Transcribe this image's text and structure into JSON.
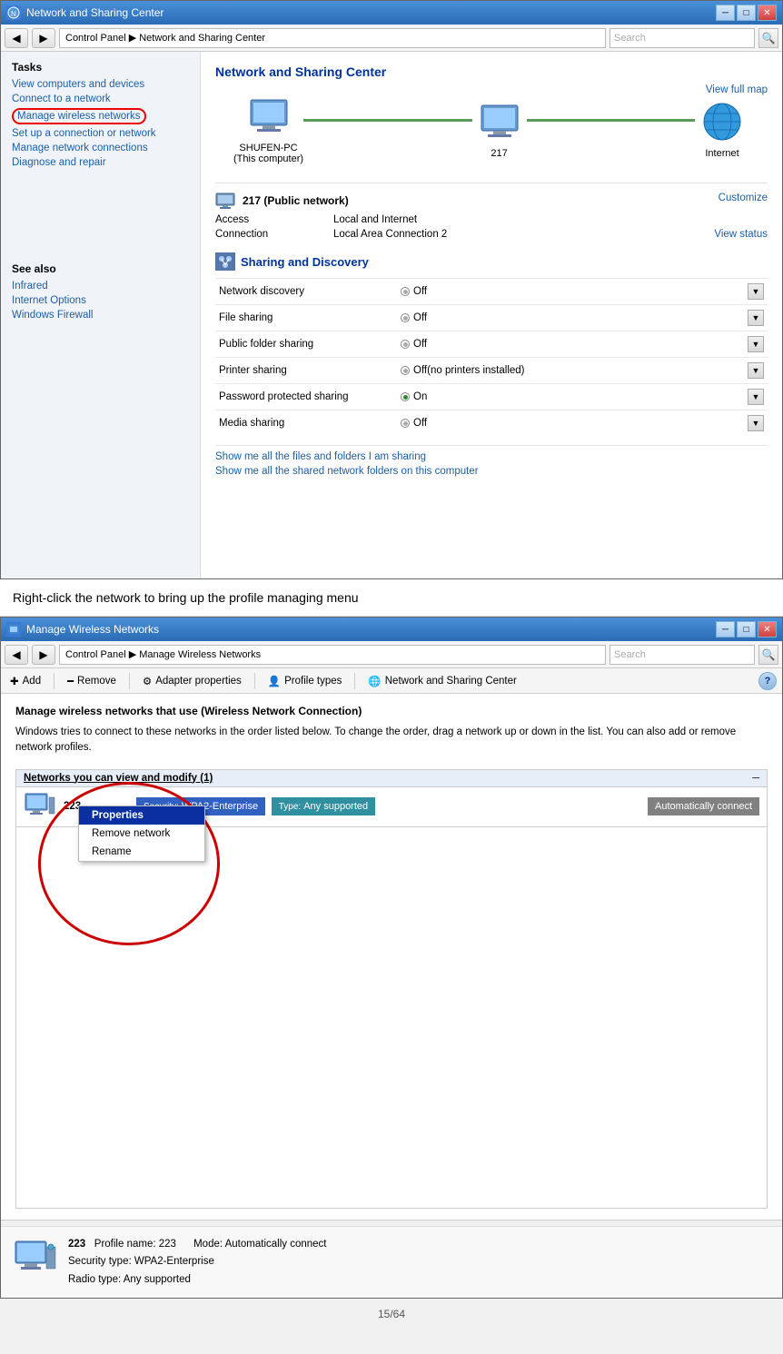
{
  "window1": {
    "title": "Network and Sharing Center",
    "address_bar": {
      "path": "Control Panel ▶ Network and Sharing Center",
      "search_placeholder": "Search"
    },
    "content_title": "Network and Sharing Center",
    "view_full_map": "View full map",
    "network_nodes": [
      {
        "label": "SHUFEN-PC\n(This computer)",
        "type": "computer"
      },
      {
        "label": "217",
        "type": "computer"
      },
      {
        "label": "Internet",
        "type": "globe"
      }
    ],
    "network_info": {
      "name": "217 (Public network)",
      "customize": "Customize",
      "rows": [
        {
          "label": "Access",
          "value": "Local and Internet"
        },
        {
          "label": "Connection",
          "value": "Local Area Connection 2",
          "link": "View status"
        }
      ]
    },
    "sharing_section": {
      "title": "Sharing and Discovery",
      "rows": [
        {
          "label": "Network discovery",
          "value": "Off",
          "status": "off"
        },
        {
          "label": "File sharing",
          "value": "Off",
          "status": "off"
        },
        {
          "label": "Public folder sharing",
          "value": "Off",
          "status": "off"
        },
        {
          "label": "Printer sharing",
          "value": "Off(no printers installed)",
          "status": "off"
        },
        {
          "label": "Password protected sharing",
          "value": "On",
          "status": "on"
        },
        {
          "label": "Media sharing",
          "value": "Off",
          "status": "off"
        }
      ],
      "links": [
        "Show me all the files and folders I am sharing",
        "Show me all the shared network folders on this computer"
      ]
    },
    "sidebar": {
      "tasks_title": "Tasks",
      "task_links": [
        {
          "text": "View computers and devices",
          "id": "view-computers"
        },
        {
          "text": "Connect to a network",
          "id": "connect-network"
        },
        {
          "text": "Manage wireless networks",
          "id": "manage-wireless",
          "highlighted": true
        },
        {
          "text": "Set up a connection or network",
          "id": "setup-connection"
        },
        {
          "text": "Manage network connections",
          "id": "manage-connections"
        },
        {
          "text": "Diagnose and repair",
          "id": "diagnose-repair"
        }
      ],
      "see_also_title": "See also",
      "see_also_links": [
        {
          "text": "Infrared",
          "id": "infrared"
        },
        {
          "text": "Internet Options",
          "id": "internet-options"
        },
        {
          "text": "Windows Firewall",
          "id": "windows-firewall"
        }
      ]
    }
  },
  "instruction": {
    "text": "Right-click the network to bring up the profile managing menu"
  },
  "window2": {
    "title": "Manage Wireless Networks",
    "address_bar": {
      "path": "Control Panel ▶ Manage Wireless Networks",
      "search_placeholder": "Search"
    },
    "toolbar": {
      "buttons": [
        {
          "label": "Add",
          "icon": "plus"
        },
        {
          "label": "Remove",
          "icon": "minus"
        },
        {
          "label": "Adapter properties",
          "icon": "adapter"
        },
        {
          "label": "Profile types",
          "icon": "profile"
        },
        {
          "label": "Network and Sharing Center",
          "icon": "network"
        }
      ]
    },
    "manage_title": "Manage wireless networks that use (Wireless Network Connection)",
    "manage_desc": "Windows tries to connect to these networks in the order listed below. To change the order, drag a network up or down in the list. You can also add or remove network profiles.",
    "networks_section": {
      "header": "Networks you can view and modify (1)",
      "networks": [
        {
          "name": "223",
          "security_label": "Security:",
          "security_value": "WPA2-Enterprise",
          "type_label": "Type:",
          "type_value": "Any supported",
          "auto_connect": "Automatically connect"
        }
      ]
    },
    "context_menu": {
      "items": [
        {
          "label": "Properties",
          "bold": true,
          "selected": true
        },
        {
          "label": "Remove network",
          "bold": false
        },
        {
          "label": "Rename",
          "bold": false
        }
      ]
    },
    "profile_footer": {
      "name": "223",
      "profile_name": "Profile name: 223",
      "mode": "Mode: Automatically connect",
      "security_type": "Security type: WPA2-Enterprise",
      "radio_type": "Radio type: Any supported"
    }
  },
  "page_number": "15/64"
}
